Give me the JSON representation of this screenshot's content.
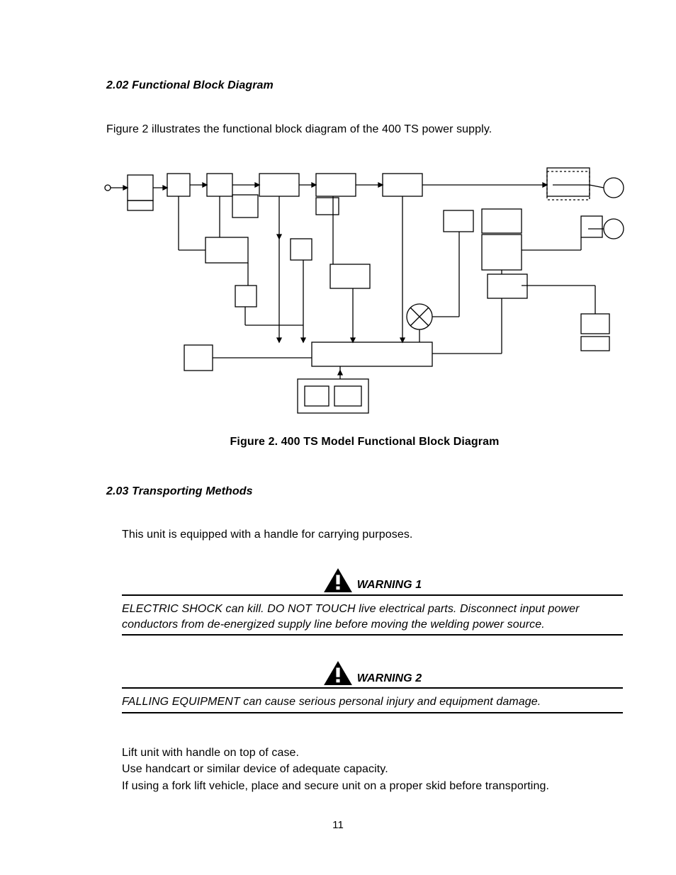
{
  "section1": {
    "heading": "2.02 Functional Block Diagram",
    "intro": "Figure 2 illustrates the functional block diagram of the 400 TS power supply.",
    "caption": "Figure 2.  400 TS Model Functional Block Diagram"
  },
  "section2": {
    "heading": "2.03 Transporting Methods",
    "intro": "This unit is equipped with a handle for carrying purposes."
  },
  "warning1": {
    "label": "WARNING 1",
    "text": "ELECTRIC SHOCK can kill. DO NOT TOUCH live electrical parts.  Disconnect input power conductors from de-energized supply line before moving the welding power source."
  },
  "warning2": {
    "label": "WARNING 2",
    "text": "FALLING EQUIPMENT can cause serious personal injury and equipment damage."
  },
  "instructions": {
    "line1": "Lift unit with handle on top of case.",
    "line2": "Use handcart or similar device of adequate capacity.",
    "line3": "If using a fork lift vehicle, place and secure unit on a proper skid before transporting."
  },
  "pageNumber": "11",
  "icons": {
    "warning": "warning-triangle"
  }
}
